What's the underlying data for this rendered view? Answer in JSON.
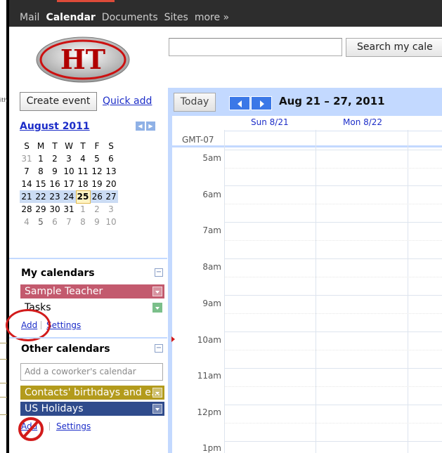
{
  "nav": {
    "items": [
      "Mail",
      "Calendar",
      "Documents",
      "Sites",
      "more »"
    ],
    "active": "Calendar"
  },
  "header": {
    "logo_text": "HT",
    "search_placeholder": "",
    "search_button": "Search my cale"
  },
  "sidebar": {
    "create_event": "Create event",
    "quick_add": "Quick add",
    "minical": {
      "month": "August 2011",
      "dow": [
        "S",
        "M",
        "T",
        "W",
        "T",
        "F",
        "S"
      ],
      "weeks": [
        [
          "31",
          "1",
          "2",
          "3",
          "4",
          "5",
          "6"
        ],
        [
          "7",
          "8",
          "9",
          "10",
          "11",
          "12",
          "13"
        ],
        [
          "14",
          "15",
          "16",
          "17",
          "18",
          "19",
          "20"
        ],
        [
          "21",
          "22",
          "23",
          "24",
          "25",
          "26",
          "27"
        ],
        [
          "28",
          "29",
          "30",
          "31",
          "1",
          "2",
          "3"
        ],
        [
          "4",
          "5",
          "6",
          "7",
          "8",
          "9",
          "10"
        ]
      ],
      "today": "25"
    },
    "my_calendars": {
      "title": "My calendars",
      "items": [
        {
          "label": "Sample Teacher",
          "color": "#c35a6e"
        },
        {
          "label": "Tasks",
          "color": "#7bbf8a"
        }
      ],
      "add": "Add",
      "settings": "Settings"
    },
    "other_calendars": {
      "title": "Other calendars",
      "coworker_placeholder": "Add a coworker's calendar",
      "items": [
        {
          "label": "Contacts' birthdays and e...",
          "color": "#b39b1c"
        },
        {
          "label": "US Holidays",
          "color": "#2f4b8c"
        }
      ],
      "add": "Add",
      "settings": "Settings"
    }
  },
  "main": {
    "today_button": "Today",
    "date_range": "Aug 21 – 27, 2011",
    "day_headers": [
      "Sun 8/21",
      "Mon 8/22"
    ],
    "timezone": "GMT-07",
    "hours": [
      "5am",
      "6am",
      "7am",
      "8am",
      "9am",
      "10am",
      "11am",
      "12pm",
      "1pm"
    ]
  },
  "colors": {
    "accent_red": "#dd4b39",
    "nav_bg": "#2d2d2d",
    "sidebar_blue": "#c3d9ff",
    "annotation_red": "#d21b1b"
  },
  "icons": [
    "prev-week-icon",
    "next-week-icon",
    "collapse-icon",
    "dropdown-arrow-icon"
  ]
}
